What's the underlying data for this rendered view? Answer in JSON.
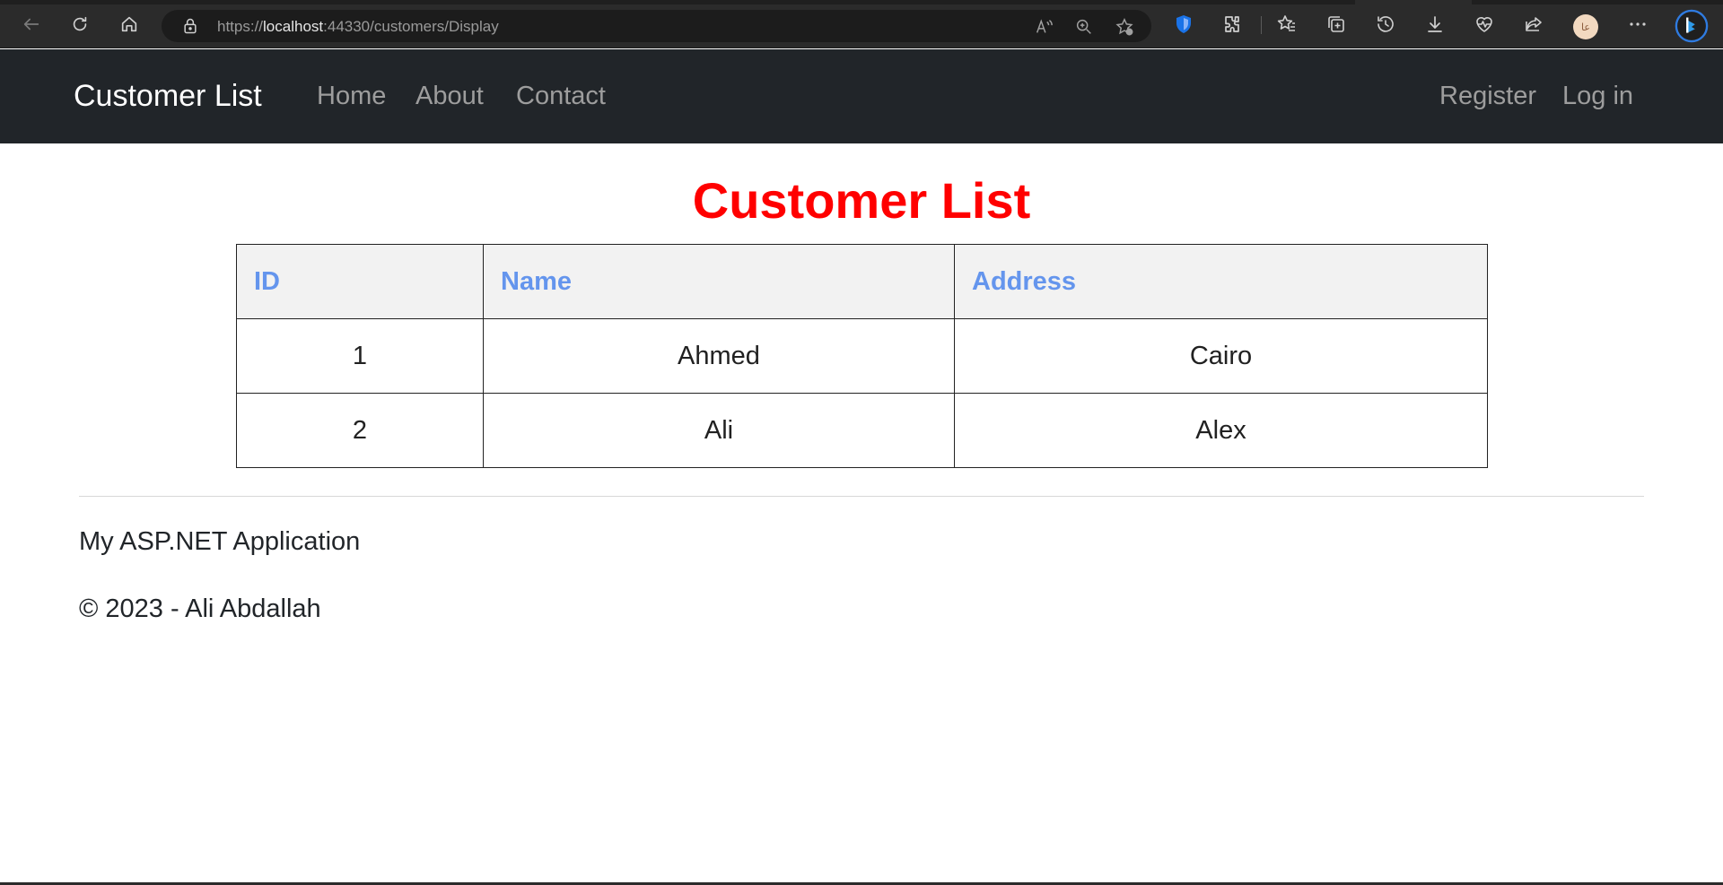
{
  "browser": {
    "url_prefix": "https://",
    "url_host": "localhost",
    "url_rest": ":44330/customers/Display",
    "profile_initials": "عا",
    "icons": [
      "back-icon",
      "refresh-icon",
      "home-icon",
      "lock-icon",
      "read-aloud-icon",
      "zoom-icon",
      "add-favorite-icon",
      "shield-extension-icon",
      "extensions-icon",
      "favorites-icon",
      "collections-icon",
      "history-icon",
      "downloads-icon",
      "health-icon",
      "share-icon",
      "more-icon",
      "copilot-icon"
    ]
  },
  "navbar": {
    "brand": "Customer List",
    "links": [
      "Home",
      "About",
      "Contact"
    ],
    "right_links": [
      "Register",
      "Log in"
    ]
  },
  "main": {
    "title": "Customer List",
    "title_color": "#ff0000",
    "table": {
      "headers": [
        "ID",
        "Name",
        "Address"
      ],
      "header_color": "#6495ed",
      "rows": [
        [
          "1",
          "Ahmed",
          "Cairo"
        ],
        [
          "2",
          "Ali",
          "Alex"
        ]
      ]
    }
  },
  "footer": {
    "app_name": "My ASP.NET Application",
    "copyright": "© 2023 - Ali Abdallah"
  }
}
